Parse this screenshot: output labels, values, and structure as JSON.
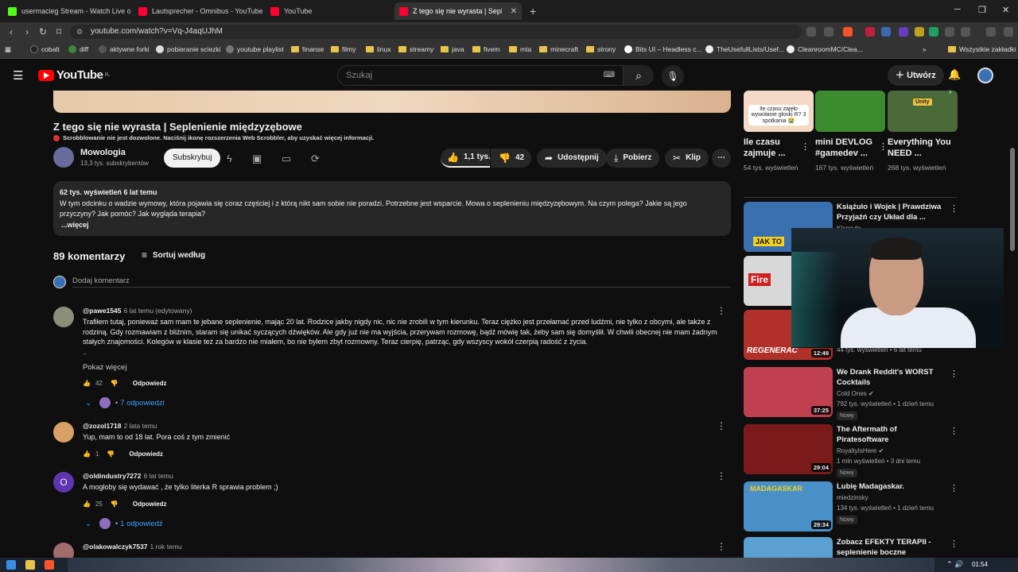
{
  "browser": {
    "tabs": [
      {
        "label": "usermacieg Stream - Watch Live on K",
        "color": "#53fc18",
        "active": false
      },
      {
        "label": "Lautsprecher - Omnibus - YouTube",
        "color": "#ff0033",
        "active": false
      },
      {
        "label": "YouTube",
        "color": "#ff0033",
        "active": false
      },
      {
        "label": "Z tego się nie wyrasta | Seplenie",
        "color": "#ff0033",
        "active": true
      }
    ],
    "new_tab": "+",
    "url": "youtube.com/watch?v=Vq-J4aqUJhM",
    "bookmarks": [
      "cobalt",
      "diff",
      "aktywne forki",
      "pobieranie sciezki",
      "youtube playlist",
      "finanse",
      "filmy",
      "linux",
      "streamy",
      "java",
      "fivem",
      "mta",
      "minecraft",
      "strony",
      "Bits UI – Headless c...",
      "TheUsefullLists/Usef...",
      "CleanroomMC/Clea...",
      "»",
      "Wszystkie zakładki"
    ]
  },
  "header": {
    "logo": "YouTube",
    "logo_region": "PL",
    "search_placeholder": "Szukaj",
    "create_label": "Utwórz"
  },
  "video": {
    "title": "Z tego się nie wyrasta | Seplenienie międzyzębowe",
    "scrobbler_notice": "Scrobblowanie nie jest dozwolone. Naciśnij ikonę rozszerzenia Web Scrobbler, aby uzyskać więcej informacji.",
    "channel_name": "Mowologia",
    "channel_subs": "13,3 tys. subskrybentów",
    "subscribe_label": "Subskrybuj",
    "likes": "1,1 tys.",
    "dislikes": "42",
    "share_label": "Udostępnij",
    "download_label": "Pobierz",
    "clip_label": "Klip",
    "views_meta": "62 tys. wyświetleń  6 lat temu",
    "description": "W tym odcinku o wadzie wymowy, która pojawia się coraz częściej i z którą nikt sam sobie nie poradzi. Potrzebne jest wsparcie. Mowa o seplenieniu międzyzębowym. Na czym polega? Jakie są jego przyczyny? Jak pomóc? Jak wygląda terapia?",
    "more_label": "...więcej"
  },
  "comments": {
    "count_label": "89 komentarzy",
    "sort_label": "Sortuj według",
    "add_placeholder": "Dodaj komentarz",
    "reply_label": "Odpowiedz",
    "items": [
      {
        "author": "@pawe1545",
        "time": "6 lat temu (edytowany)",
        "text": "Trafiłem tutaj, ponieważ sam mam te jebane seplenienie, mając 20 lat. Rodzice jakby nigdy nic, nic nie zrobili w tym kierunku. Teraz ciężko jest przełamać przed ludźmi, nie tylko z obcymi, ale także z rodziną. Gdy rozmawiam z bliźnim, staram się unikać syczących dźwięków. Ale gdy już nie ma wyjścia, przerywam rozmowę, bądź mówię tak, żeby sam się domyślił. W chwili obecnej nie mam żadnym stałych znajomości. Kolegów w klasie też za bardzo nie miałem, bo nie byłem zbyt rozmowny. Teraz cierpię, patrząc, gdy wszyscy wokół czerpią radość z życia.",
        "ellipsis": "..",
        "show_more": "Pokaż więcej",
        "likes": "42",
        "replies": "7 odpowiedzi",
        "avatar_color": "#8a8f7a"
      },
      {
        "author": "@zozol1718",
        "time": "2 lata temu",
        "text": "Yup, mam to od 18 lat. Pora coś z tym zmienić",
        "likes": "1",
        "avatar_color": "#d9a066"
      },
      {
        "author": "@oldindustry7272",
        "time": "6 lat temu",
        "text": "A mogłoby się wydawać , że tylko literka R sprawia problem ;)",
        "likes": "25",
        "replies": "1 odpowiedź",
        "avatar_letter": "O",
        "avatar_color": "#5e35b1"
      },
      {
        "author": "@olakowalczyk7537",
        "time": "1 rok temu",
        "avatar_color": "#a06c6c"
      }
    ]
  },
  "shelf": [
    {
      "title": "Ile czasu zajmuje ...",
      "meta": "54 tys. wyświetleń",
      "thumb_text": "Ile czasu zajęło wywołanie głoski R? 3 spotkania 😭",
      "thumb_color": "#f4d9c6"
    },
    {
      "title": "mini DEVLOG #gamedev ...",
      "meta": "167 tys. wyświetleń",
      "thumb_color": "#3d8b2f"
    },
    {
      "title": "Everything You NEED ...",
      "meta": "268 tys. wyświetleń",
      "thumb_text": "Unity",
      "thumb_color": "#4a6a3a"
    }
  ],
  "sidebar": [
    {
      "title": "Książulo i Wojek | Prawdziwa Przyjaźń czy Układ dla ...",
      "channel": "Klapsylo",
      "thumb_color": "#3a6fb0",
      "thumb_text": "JAK TO"
    },
    {
      "title": "",
      "thumb_color": "#d8d8d8",
      "thumb_text": "Fire"
    },
    {
      "title": "",
      "stats": "44 tys. wyświetleń • 6 lat temu",
      "duration": "12:49",
      "thumb_color": "#b0302a",
      "thumb_text": "REGENERAC"
    },
    {
      "title": "We Drank Reddit's WORST Cocktails",
      "channel": "Cold Ones",
      "stats": "792 tys. wyświetleń • 1 dzień temu",
      "badge": "Nowy",
      "duration": "37:25",
      "thumb_color": "#c04050"
    },
    {
      "title": "The Aftermath of Piratesoftware",
      "channel": "RoyaltyIsHere",
      "stats": "1 mln wyświetleń • 3 dni temu",
      "badge": "Nowy",
      "duration": "29:04",
      "thumb_color": "#7a1a1a"
    },
    {
      "title": "Lubię Madagaskar.",
      "channel": "miedzinsky",
      "stats": "134 tys. wyświetleń • 1 dzień temu",
      "badge": "Nowy",
      "duration": "29:34",
      "thumb_color": "#4a90c8",
      "thumb_text": "MADAGASKAR"
    },
    {
      "title": "Zobacz EFEKTY TERAPII - seplenienie boczne",
      "thumb_color": "#5aa0d0"
    }
  ],
  "taskbar": {
    "time": "01:54"
  }
}
